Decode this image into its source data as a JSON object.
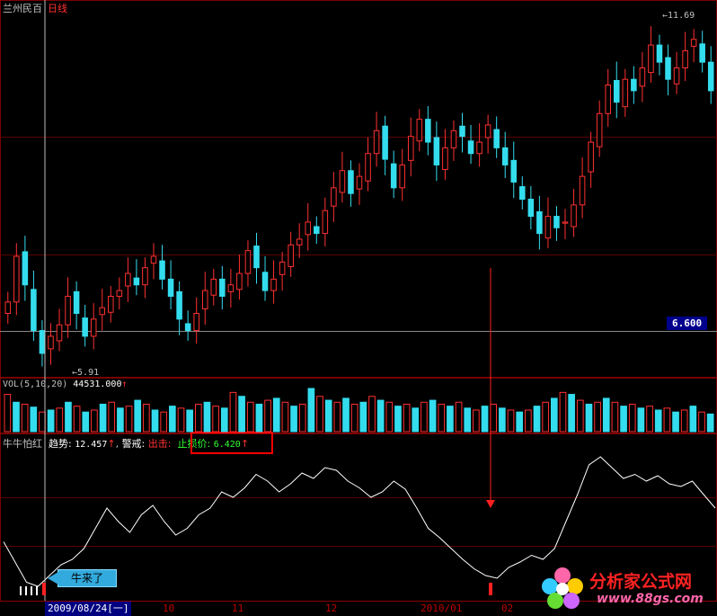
{
  "header": {
    "stock_name": "兰州民百",
    "period": "日线",
    "high_marker": "11.69",
    "low_marker": "5.91"
  },
  "price_axis": {
    "current_price_label": "6.600"
  },
  "volume_panel": {
    "label": "VOL(5,10,20)",
    "value": "44531.000"
  },
  "indicator_panel": {
    "name": "牛牛怕红",
    "trend_label": "趋势:",
    "trend_value": "12.457",
    "alert_label": "警戒:",
    "strike_label": "出击:",
    "stop_loss_label": "止损价:",
    "stop_loss_value": "6.420",
    "callout_text": "牛来了"
  },
  "x_axis": {
    "selected_date": "2009/08/24[一]",
    "ticks": [
      "10",
      "11",
      "12",
      "2010/01",
      "02"
    ]
  },
  "watermark": {
    "brand": "分析家公式网",
    "url": "www.88gs.com"
  },
  "colors": {
    "up": "#ff3030",
    "down": "#33ddee",
    "grid": "#6a0000",
    "indicator_line": "#ffffff",
    "price_tag_bg": "#00008c"
  },
  "chart_data": {
    "type": "candlestick",
    "prices": {
      "high": 11.69,
      "low": 5.91,
      "current": 6.6,
      "close_series": [
        6.8,
        7.6,
        7.1,
        6.3,
        5.9,
        6.2,
        6.4,
        6.9,
        6.6,
        6.2,
        6.5,
        6.7,
        6.9,
        7.0,
        7.3,
        7.1,
        7.4,
        7.6,
        7.2,
        6.9,
        6.5,
        6.3,
        6.6,
        7.0,
        7.2,
        6.9,
        7.1,
        7.3,
        7.7,
        7.4,
        7.0,
        7.2,
        7.5,
        7.8,
        7.9,
        8.2,
        8.0,
        8.4,
        8.8,
        9.1,
        8.7,
        9.0,
        9.4,
        9.8,
        9.3,
        8.8,
        9.2,
        9.7,
        10.0,
        9.6,
        9.2,
        9.5,
        9.8,
        9.7,
        9.4,
        9.6,
        9.9,
        9.5,
        9.2,
        8.9,
        8.6,
        8.3,
        8.0,
        8.3,
        8.1,
        8.2,
        8.5,
        9.0,
        9.6,
        10.1,
        10.6,
        10.3,
        10.7,
        10.5,
        10.9,
        11.3,
        11.0,
        10.7,
        10.9,
        11.2,
        11.4,
        11.0,
        10.5
      ]
    },
    "volume": [
      38,
      30,
      28,
      25,
      20,
      22,
      24,
      30,
      26,
      20,
      22,
      28,
      30,
      24,
      26,
      32,
      28,
      22,
      20,
      26,
      24,
      22,
      28,
      30,
      26,
      24,
      40,
      36,
      30,
      28,
      32,
      34,
      30,
      26,
      28,
      44,
      36,
      32,
      30,
      34,
      28,
      30,
      36,
      32,
      30,
      26,
      28,
      24,
      30,
      32,
      28,
      26,
      30,
      24,
      22,
      26,
      28,
      24,
      22,
      20,
      22,
      26,
      30,
      34,
      40,
      38,
      32,
      28,
      30,
      34,
      30,
      26,
      28,
      24,
      26,
      22,
      24,
      20,
      22,
      26,
      20,
      18
    ],
    "indicator": [
      0.35,
      0.2,
      0.05,
      0.02,
      0.1,
      0.18,
      0.22,
      0.3,
      0.45,
      0.6,
      0.5,
      0.42,
      0.55,
      0.62,
      0.5,
      0.4,
      0.45,
      0.55,
      0.6,
      0.72,
      0.68,
      0.75,
      0.85,
      0.8,
      0.72,
      0.78,
      0.86,
      0.82,
      0.9,
      0.88,
      0.8,
      0.75,
      0.68,
      0.72,
      0.8,
      0.74,
      0.6,
      0.45,
      0.38,
      0.3,
      0.22,
      0.15,
      0.1,
      0.08,
      0.16,
      0.2,
      0.25,
      0.22,
      0.3,
      0.5,
      0.7,
      0.92,
      0.98,
      0.9,
      0.82,
      0.85,
      0.8,
      0.84,
      0.78,
      0.76,
      0.8,
      0.7,
      0.6
    ],
    "ylim": [
      5.6,
      11.9
    ]
  }
}
